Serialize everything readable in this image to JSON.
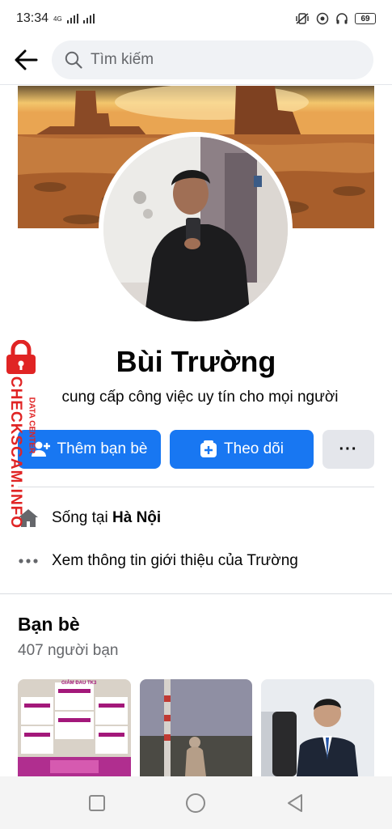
{
  "status_bar": {
    "time": "13:34",
    "network_label": "4G",
    "battery": "69"
  },
  "search": {
    "placeholder": "Tìm kiếm"
  },
  "profile": {
    "name": "Bùi Trường",
    "bio": "cung cấp công việc uy tín cho mọi người"
  },
  "actions": {
    "add_friend": "Thêm bạn bè",
    "follow": "Theo dõi",
    "more": "···"
  },
  "info": {
    "lives_in_prefix": "Sống tại ",
    "lives_in_city": "Hà Nội",
    "see_about": "Xem thông tin giới thiệu của Trường"
  },
  "friends": {
    "title": "Bạn bè",
    "count": "407 người bạn",
    "tiles": [
      {
        "caption": "GIẢM ĐAU TK3"
      },
      {
        "caption": ""
      },
      {
        "caption": ""
      }
    ]
  },
  "watermark": {
    "line1": "DATA CENTER",
    "line2": "CHECKSCAM.INFO"
  },
  "colors": {
    "accent": "#1877f2",
    "secondary_button": "#e4e6eb",
    "muted_text": "#65676b",
    "watermark": "#e02424"
  }
}
